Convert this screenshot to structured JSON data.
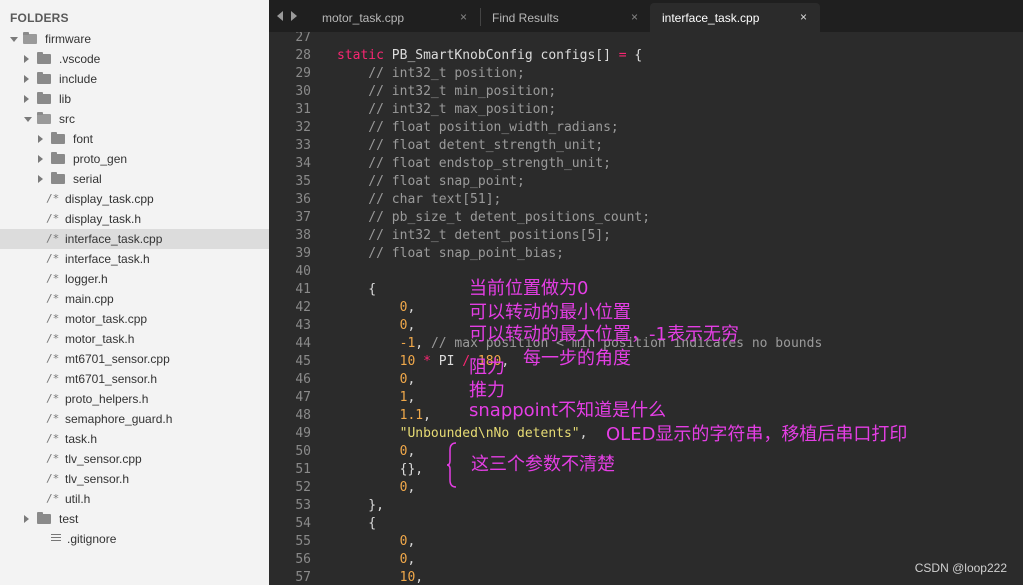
{
  "sidebar": {
    "header": "FOLDERS",
    "items": [
      {
        "label": "firmware",
        "kind": "folder",
        "open": true,
        "depth": 0
      },
      {
        "label": ".vscode",
        "kind": "folder",
        "open": false,
        "depth": 1
      },
      {
        "label": "include",
        "kind": "folder",
        "open": false,
        "depth": 1
      },
      {
        "label": "lib",
        "kind": "folder",
        "open": false,
        "depth": 1
      },
      {
        "label": "src",
        "kind": "folder",
        "open": true,
        "depth": 1
      },
      {
        "label": "font",
        "kind": "folder",
        "open": false,
        "depth": 2
      },
      {
        "label": "proto_gen",
        "kind": "folder",
        "open": false,
        "depth": 2
      },
      {
        "label": "serial",
        "kind": "folder",
        "open": false,
        "depth": 2
      },
      {
        "label": "display_task.cpp",
        "kind": "file",
        "depth": 2
      },
      {
        "label": "display_task.h",
        "kind": "file",
        "depth": 2
      },
      {
        "label": "interface_task.cpp",
        "kind": "file",
        "depth": 2,
        "selected": true
      },
      {
        "label": "interface_task.h",
        "kind": "file",
        "depth": 2
      },
      {
        "label": "logger.h",
        "kind": "file",
        "depth": 2
      },
      {
        "label": "main.cpp",
        "kind": "file",
        "depth": 2
      },
      {
        "label": "motor_task.cpp",
        "kind": "file",
        "depth": 2
      },
      {
        "label": "motor_task.h",
        "kind": "file",
        "depth": 2
      },
      {
        "label": "mt6701_sensor.cpp",
        "kind": "file",
        "depth": 2
      },
      {
        "label": "mt6701_sensor.h",
        "kind": "file",
        "depth": 2
      },
      {
        "label": "proto_helpers.h",
        "kind": "file",
        "depth": 2
      },
      {
        "label": "semaphore_guard.h",
        "kind": "file",
        "depth": 2
      },
      {
        "label": "task.h",
        "kind": "file",
        "depth": 2
      },
      {
        "label": "tlv_sensor.cpp",
        "kind": "file",
        "depth": 2
      },
      {
        "label": "tlv_sensor.h",
        "kind": "file",
        "depth": 2
      },
      {
        "label": "util.h",
        "kind": "file",
        "depth": 2
      },
      {
        "label": "test",
        "kind": "folder",
        "open": false,
        "depth": 1
      },
      {
        "label": ".gitignore",
        "kind": "text",
        "depth": 1
      }
    ]
  },
  "tabs": [
    {
      "label": "motor_task.cpp",
      "close": "×",
      "active": false
    },
    {
      "label": "Find Results",
      "close": "×",
      "active": false
    },
    {
      "label": "interface_task.cpp",
      "close": "×",
      "active": true
    }
  ],
  "editor": {
    "lines": [
      {
        "n": "27",
        "segs": []
      },
      {
        "n": "28",
        "segs": [
          [
            "kw",
            "static"
          ],
          [
            "t",
            " PB_SmartKnobConfig configs[] "
          ],
          [
            "op",
            "="
          ],
          [
            "t",
            " {"
          ]
        ]
      },
      {
        "n": "29",
        "segs": [
          [
            "cm",
            "    // int32_t position;"
          ]
        ]
      },
      {
        "n": "30",
        "segs": [
          [
            "cm",
            "    // int32_t min_position;"
          ]
        ]
      },
      {
        "n": "31",
        "segs": [
          [
            "cm",
            "    // int32_t max_position;"
          ]
        ]
      },
      {
        "n": "32",
        "segs": [
          [
            "cm",
            "    // float position_width_radians;"
          ]
        ]
      },
      {
        "n": "33",
        "segs": [
          [
            "cm",
            "    // float detent_strength_unit;"
          ]
        ]
      },
      {
        "n": "34",
        "segs": [
          [
            "cm",
            "    // float endstop_strength_unit;"
          ]
        ]
      },
      {
        "n": "35",
        "segs": [
          [
            "cm",
            "    // float snap_point;"
          ]
        ]
      },
      {
        "n": "36",
        "segs": [
          [
            "cm",
            "    // char text[51];"
          ]
        ]
      },
      {
        "n": "37",
        "segs": [
          [
            "cm",
            "    // pb_size_t detent_positions_count;"
          ]
        ]
      },
      {
        "n": "38",
        "segs": [
          [
            "cm",
            "    // int32_t detent_positions[5];"
          ]
        ]
      },
      {
        "n": "39",
        "segs": [
          [
            "cm",
            "    // float snap_point_bias;"
          ]
        ]
      },
      {
        "n": "40",
        "segs": []
      },
      {
        "n": "41",
        "segs": [
          [
            "t",
            "    {"
          ]
        ]
      },
      {
        "n": "42",
        "segs": [
          [
            "t",
            "        "
          ],
          [
            "numo",
            "0"
          ],
          [
            "t",
            ","
          ]
        ]
      },
      {
        "n": "43",
        "segs": [
          [
            "t",
            "        "
          ],
          [
            "numo",
            "0"
          ],
          [
            "t",
            ","
          ]
        ]
      },
      {
        "n": "44",
        "segs": [
          [
            "t",
            "        "
          ],
          [
            "numo",
            "-1"
          ],
          [
            "t",
            ", "
          ],
          [
            "cm",
            "// max position < min position indicates no bounds"
          ]
        ]
      },
      {
        "n": "45",
        "segs": [
          [
            "t",
            "        "
          ],
          [
            "numo",
            "10"
          ],
          [
            "t",
            " "
          ],
          [
            "op",
            "*"
          ],
          [
            "t",
            " PI "
          ],
          [
            "op",
            "/"
          ],
          [
            "t",
            " "
          ],
          [
            "numo",
            "180"
          ],
          [
            "t",
            ","
          ]
        ]
      },
      {
        "n": "46",
        "segs": [
          [
            "t",
            "        "
          ],
          [
            "numo",
            "0"
          ],
          [
            "t",
            ","
          ]
        ]
      },
      {
        "n": "47",
        "segs": [
          [
            "t",
            "        "
          ],
          [
            "numo",
            "1"
          ],
          [
            "t",
            ","
          ]
        ]
      },
      {
        "n": "48",
        "segs": [
          [
            "t",
            "        "
          ],
          [
            "numo",
            "1.1"
          ],
          [
            "t",
            ","
          ]
        ]
      },
      {
        "n": "49",
        "segs": [
          [
            "t",
            "        "
          ],
          [
            "str",
            "\"Unbounded\\nNo detents\""
          ],
          [
            "t",
            ","
          ]
        ]
      },
      {
        "n": "50",
        "segs": [
          [
            "t",
            "        "
          ],
          [
            "numo",
            "0"
          ],
          [
            "t",
            ","
          ]
        ]
      },
      {
        "n": "51",
        "segs": [
          [
            "t",
            "        {},"
          ]
        ]
      },
      {
        "n": "52",
        "segs": [
          [
            "t",
            "        "
          ],
          [
            "numo",
            "0"
          ],
          [
            "t",
            ","
          ]
        ]
      },
      {
        "n": "53",
        "segs": [
          [
            "t",
            "    },"
          ]
        ]
      },
      {
        "n": "54",
        "segs": [
          [
            "t",
            "    {"
          ]
        ]
      },
      {
        "n": "55",
        "segs": [
          [
            "t",
            "        "
          ],
          [
            "numo",
            "0"
          ],
          [
            "t",
            ","
          ]
        ]
      },
      {
        "n": "56",
        "segs": [
          [
            "t",
            "        "
          ],
          [
            "numo",
            "0"
          ],
          [
            "t",
            ","
          ]
        ]
      },
      {
        "n": "57",
        "segs": [
          [
            "t",
            "        "
          ],
          [
            "numo",
            "10"
          ],
          [
            "t",
            ","
          ]
        ]
      }
    ]
  },
  "annotations": {
    "a1": "当前位置做为0",
    "a2": "可以转动的最小位置",
    "a3": "可以转动的最大位置，-1表示无穷",
    "a4": "每一步的角度",
    "a5": "阻力",
    "a6": "推力",
    "a7": "snappoint不知道是什么",
    "a8": "OLED显示的字符串，移植后串口打印",
    "a9": "这三个参数不清楚"
  },
  "watermark": "CSDN @loop222",
  "colors": {
    "annotation": "#e43ee4",
    "keyword": "#f92672",
    "number": "#f0a84a",
    "string": "#e6db74",
    "comment": "#9a9a9a"
  }
}
